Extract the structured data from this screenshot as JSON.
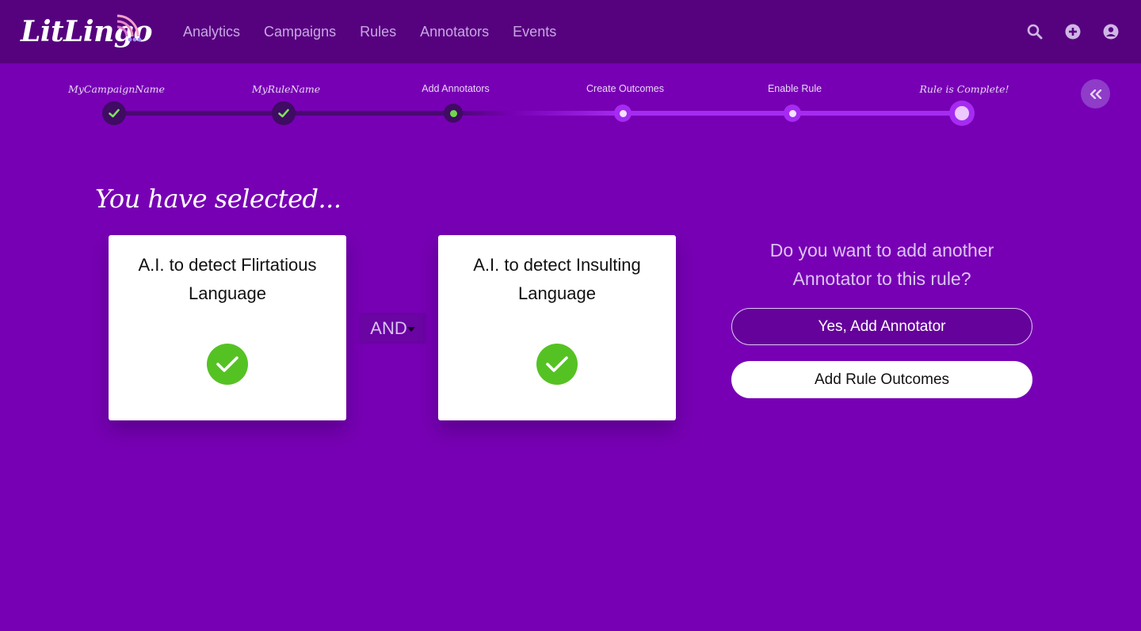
{
  "brand": {
    "name": "LitLingo"
  },
  "nav": {
    "items": [
      "Analytics",
      "Campaigns",
      "Rules",
      "Annotators",
      "Events"
    ]
  },
  "header_icons": [
    "search-icon",
    "plus-circle-icon",
    "user-circle-icon"
  ],
  "stepper": {
    "steps": [
      {
        "label": "MyCampaignName",
        "state": "complete"
      },
      {
        "label": "MyRuleName",
        "state": "complete"
      },
      {
        "label": "Add Annotators",
        "state": "current"
      },
      {
        "label": "Create Outcomes",
        "state": "upcoming"
      },
      {
        "label": "Enable Rule",
        "state": "upcoming"
      },
      {
        "label": "Rule is Complete!",
        "state": "final"
      }
    ],
    "collapse_icon": "double-chevron-left-icon"
  },
  "main": {
    "heading": "You have selected...",
    "cards": [
      {
        "title": "A.I. to detect Flirtatious Language",
        "status": "selected"
      },
      {
        "title": "A.I. to detect Insulting Language",
        "status": "selected"
      }
    ],
    "operator": {
      "value": "AND"
    },
    "question": "Do you want to add another Annotator to this rule?",
    "buttons": {
      "add_annotator": "Yes, Add Annotator",
      "add_outcomes": "Add Rule Outcomes"
    }
  },
  "colors": {
    "background": "#7700b4",
    "header": "#56027e",
    "check_green": "#55c224",
    "current_dot": "#6fd84a"
  }
}
